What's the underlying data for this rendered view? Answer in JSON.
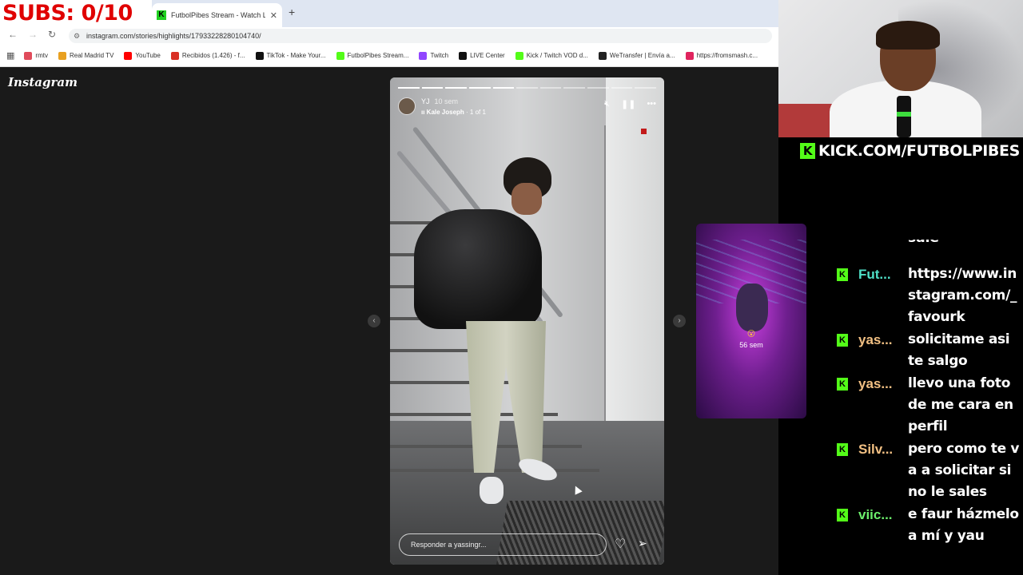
{
  "overlay": {
    "subs_counter": "SUBS: 0/10",
    "kick_url": "KICK.COM/FUTBOLPIBES"
  },
  "browser": {
    "tab_title": "FutbolPibes Stream - Watch Liv",
    "url": "instagram.com/stories/highlights/17933228280104740/",
    "bookmarks": [
      {
        "label": "rmtv",
        "icon": "rmtv-icon",
        "color": "#e04b5b"
      },
      {
        "label": "Real Madrid TV",
        "icon": "play-icon",
        "color": "#e8a020"
      },
      {
        "label": "YouTube",
        "icon": "youtube-icon",
        "color": "#ff0000"
      },
      {
        "label": "Recibidos (1.426) - f...",
        "icon": "gmail-icon",
        "color": "#d93025"
      },
      {
        "label": "TikTok - Make Your...",
        "icon": "tiktok-icon",
        "color": "#111111"
      },
      {
        "label": "FutbolPibes Stream...",
        "icon": "kick-icon",
        "color": "#53fc18"
      },
      {
        "label": "Twitch",
        "icon": "twitch-icon",
        "color": "#9146ff"
      },
      {
        "label": "LIVE Center",
        "icon": "tiktok-icon",
        "color": "#111111"
      },
      {
        "label": "Kick / Twitch VOD d...",
        "icon": "kick-icon",
        "color": "#53fc18"
      },
      {
        "label": "WeTransfer | Envía a...",
        "icon": "wetransfer-icon",
        "color": "#222222"
      },
      {
        "label": "https://fromsmash.c...",
        "icon": "smash-icon",
        "color": "#e0245e"
      }
    ]
  },
  "instagram": {
    "logo": "Instagram",
    "story": {
      "username": "YJ",
      "time": "10 sem",
      "audio": "Kale Joseph",
      "audio_count": " · 1 of 1",
      "reply_placeholder": "Responder a yassingr..."
    },
    "next_story": {
      "emoji": "😮",
      "age": "56 sem"
    }
  },
  "chat": [
    {
      "user": "Fut...",
      "color": "#4fe0c8",
      "message": "https://www.instagram.com/_favourk"
    },
    {
      "user": "yas...",
      "color": "#f2c083",
      "message": "solicitame asi te salgo"
    },
    {
      "user": "yas...",
      "color": "#f2c083",
      "message": "llevo una foto de me cara en perfil"
    },
    {
      "user": "Silv...",
      "color": "#f2c083",
      "message": "pero como te va a solicitar si no le sales"
    },
    {
      "user": "viic...",
      "color": "#6cf06c",
      "message": "e faur házmelo a mí y yau"
    }
  ],
  "chat_cutoff": "sale"
}
